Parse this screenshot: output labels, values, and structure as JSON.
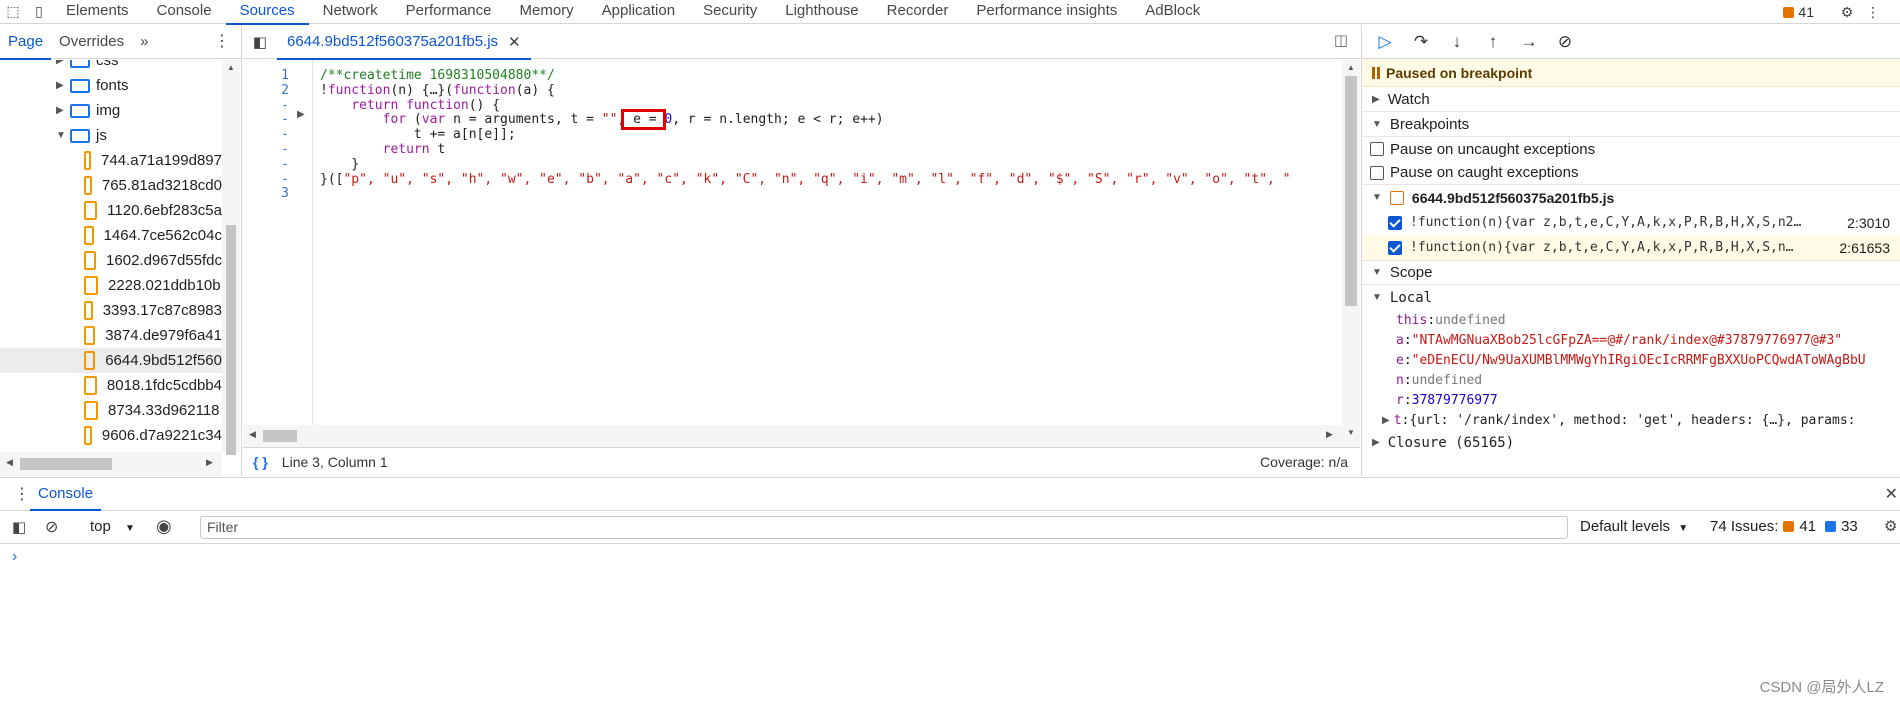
{
  "top_tabs": [
    "Elements",
    "Console",
    "Sources",
    "Network",
    "Performance",
    "Memory",
    "Application",
    "Security",
    "Lighthouse",
    "Recorder",
    "Performance insights",
    "AdBlock"
  ],
  "top_active_index": 2,
  "issues_count": "41",
  "navigator": {
    "tabs": [
      "Page",
      "Overrides"
    ],
    "more": "»",
    "tree": [
      {
        "label": "css",
        "type": "folder",
        "depth": 1,
        "expanded": false
      },
      {
        "label": "fonts",
        "type": "folder",
        "depth": 1,
        "expanded": false
      },
      {
        "label": "img",
        "type": "folder",
        "depth": 1,
        "expanded": false
      },
      {
        "label": "js",
        "type": "folder",
        "depth": 1,
        "expanded": true
      },
      {
        "label": "744.a71a199d897",
        "type": "file",
        "depth": 2
      },
      {
        "label": "765.81ad3218cd0",
        "type": "file",
        "depth": 2
      },
      {
        "label": "1120.6ebf283c5a",
        "type": "file",
        "depth": 2
      },
      {
        "label": "1464.7ce562c04c",
        "type": "file",
        "depth": 2
      },
      {
        "label": "1602.d967d55fdc",
        "type": "file",
        "depth": 2
      },
      {
        "label": "2228.021ddb10b",
        "type": "file",
        "depth": 2
      },
      {
        "label": "3393.17c87c8983",
        "type": "file",
        "depth": 2
      },
      {
        "label": "3874.de979f6a41",
        "type": "file",
        "depth": 2
      },
      {
        "label": "6644.9bd512f560",
        "type": "file",
        "depth": 2,
        "selected": true
      },
      {
        "label": "8018.1fdc5cdbb4",
        "type": "file",
        "depth": 2
      },
      {
        "label": "8734.33d96211​8",
        "type": "file",
        "depth": 2
      },
      {
        "label": "9606.d7a9221c34",
        "type": "file",
        "depth": 2
      }
    ]
  },
  "editor": {
    "file_tab": "6644.9bd512f560375a201fb5.js",
    "line_numbers": [
      "1",
      "2",
      "-",
      "-",
      "-",
      "-",
      "-",
      "-",
      "3"
    ],
    "lines": [
      [
        {
          "t": "/**createtime 1698310504880**/",
          "c": "cm"
        }
      ],
      [
        {
          "t": "!",
          "c": ""
        },
        {
          "t": "function",
          "c": "kw"
        },
        {
          "t": "(n) {…}(",
          "c": ""
        },
        {
          "t": "function",
          "c": "kw"
        },
        {
          "t": "(a) {",
          "c": ""
        }
      ],
      [
        {
          "t": "    ",
          "c": ""
        },
        {
          "t": "return",
          "c": "kw"
        },
        {
          "t": " ",
          "c": ""
        },
        {
          "t": "function",
          "c": "kw"
        },
        {
          "t": "() {",
          "c": ""
        }
      ],
      [
        {
          "t": "        ",
          "c": ""
        },
        {
          "t": "for",
          "c": "kw"
        },
        {
          "t": " (",
          "c": ""
        },
        {
          "t": "var",
          "c": "kw"
        },
        {
          "t": " n = arguments, t = ",
          "c": ""
        },
        {
          "t": "\"\"",
          "c": "st"
        },
        {
          "t": ", e = ",
          "c": ""
        },
        {
          "t": "0",
          "c": "nm"
        },
        {
          "t": ", r = n.length; e < r; e++)",
          "c": ""
        }
      ],
      [
        {
          "t": "            t += a[n[e]];",
          "c": ""
        }
      ],
      [
        {
          "t": "        ",
          "c": ""
        },
        {
          "t": "return",
          "c": "kw"
        },
        {
          "t": " t",
          "c": ""
        }
      ],
      [
        {
          "t": "    }",
          "c": ""
        }
      ],
      [
        {
          "t": "}([",
          "c": ""
        },
        {
          "t": "\"p\", \"u\", \"s\", \"h\", \"w\", \"e\", \"b\", \"a\", \"c\", \"k\", \"C\", \"n\", \"q\", \"i\", \"m\", \"l\", \"f\", \"d\", \"$\", \"S\", \"r\", \"v\", \"o\", \"t\", \"",
          "c": "st"
        }
      ],
      []
    ],
    "status_position": "Line 3, Column 1",
    "coverage": "Coverage: n/a"
  },
  "debugger": {
    "paused_text": "Paused on breakpoint",
    "watch_label": "Watch",
    "breakpoints_label": "Breakpoints",
    "pause_uncaught": "Pause on uncaught exceptions",
    "pause_caught": "Pause on caught exceptions",
    "bp_file": "6644.9bd512f560375a201fb5.js",
    "breakpoints": [
      {
        "code": "!function(n){var z,b,t,e,C,Y,A,k,x,P,R,B,H,X,S,n2…",
        "loc": "2:3010",
        "current": false
      },
      {
        "code": "!function(n){var z,b,t,e,C,Y,A,k,x,P,R,B,H,X,S,n…",
        "loc": "2:61653",
        "current": true
      }
    ],
    "scope_label": "Scope",
    "local_label": "Local",
    "scope_vars": [
      {
        "key": "this",
        "value": "undefined",
        "kind": "undef",
        "expandable": false
      },
      {
        "key": "a",
        "value": "\"NTAwMGNuaXBob25lcGFpZA==@#/rank/index@#37879776977@#3\"",
        "kind": "str",
        "expandable": false
      },
      {
        "key": "e",
        "value": "\"eDEnECU/Nw9UaXUMBlMMWgYhIRgiOEcIcRRMFgBXXUoPCQwdAToWAgBbU",
        "kind": "str",
        "expandable": false
      },
      {
        "key": "n",
        "value": "undefined",
        "kind": "undef",
        "expandable": false
      },
      {
        "key": "r",
        "value": "37879776977",
        "kind": "num",
        "expandable": false
      },
      {
        "key": "t",
        "value": "{url: '/rank/index', method: 'get', headers: {…}, params:",
        "kind": "obj",
        "expandable": true
      }
    ],
    "closure_label": "Closure (65165)"
  },
  "console": {
    "tab": "Console",
    "context": "top",
    "filter_placeholder": "Filter",
    "levels": "Default levels",
    "issues_label": "74 Issues:",
    "issues_warn": "41",
    "issues_info": "33",
    "prompt": "›"
  },
  "watermark": "CSDN @局外人LZ"
}
